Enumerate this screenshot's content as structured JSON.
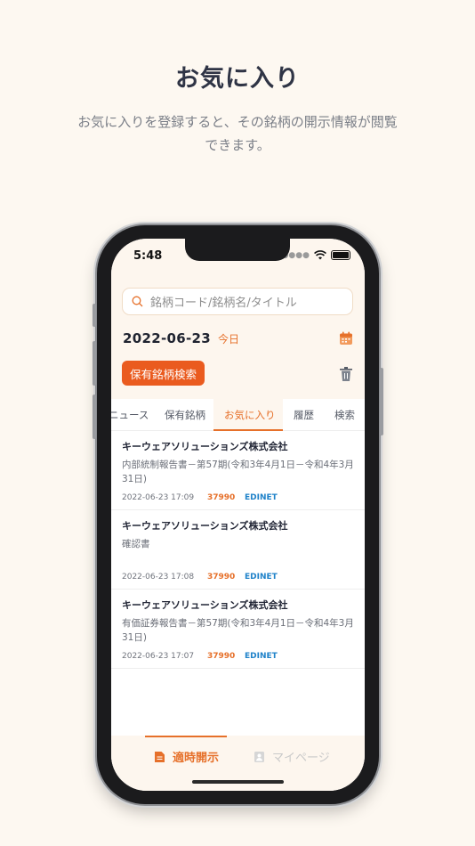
{
  "heading": {
    "title": "お気に入り",
    "subtitle": "お気に入りを登録すると、その銘柄の開示情報が閲覧できます。"
  },
  "status_bar": {
    "time": "5:48"
  },
  "search": {
    "placeholder": "銘柄コード/銘柄名/タイトル"
  },
  "date_bar": {
    "date": "2022-06-23",
    "today_label": "今日"
  },
  "holdings_search_label": "保有銘柄検索",
  "tabs": [
    {
      "label": "ニュース",
      "active": false
    },
    {
      "label": "保有銘柄",
      "active": false
    },
    {
      "label": "お気に入り",
      "active": true
    },
    {
      "label": "履歴",
      "active": false
    },
    {
      "label": "検索",
      "active": false
    }
  ],
  "items": [
    {
      "company": "キーウェアソリューションズ株式会社",
      "title": "内部統制報告書－第57期(令和3年4月1日－令和4年3月31日)",
      "datetime": "2022-06-23 17:09",
      "code": "37990",
      "source": "EDINET"
    },
    {
      "company": "キーウェアソリューションズ株式会社",
      "title": "確認書",
      "datetime": "2022-06-23 17:08",
      "code": "37990",
      "source": "EDINET"
    },
    {
      "company": "キーウェアソリューションズ株式会社",
      "title": "有価証券報告書－第57期(令和3年4月1日－令和4年3月31日)",
      "datetime": "2022-06-23 17:07",
      "code": "37990",
      "source": "EDINET"
    }
  ],
  "tab_bar": {
    "disclosure_label": "適時開示",
    "mypage_label": "マイページ"
  },
  "colors": {
    "accent": "#e6702a",
    "button": "#ea5b1f",
    "source_link": "#1f82c9",
    "background": "#fdf8f1"
  },
  "icons": [
    "search-icon",
    "calendar-icon",
    "trash-icon",
    "document-icon",
    "user-icon",
    "wifi-icon",
    "battery-icon"
  ]
}
